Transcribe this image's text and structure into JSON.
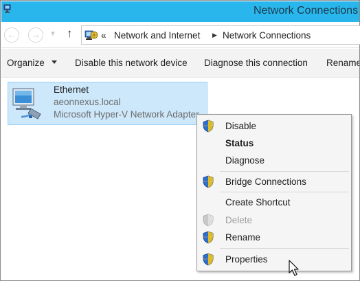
{
  "window": {
    "title": "Network Connections"
  },
  "navigation": {
    "back_icon": "back-arrow-icon",
    "forward_icon": "forward-arrow-icon",
    "up_icon": "up-arrow-icon",
    "overflow": "«",
    "breadcrumbs": [
      "Network and Internet",
      "Network Connections"
    ]
  },
  "commandbar": {
    "organize": "Organize",
    "disable": "Disable this network device",
    "diagnose": "Diagnose this connection",
    "rename": "Rename this connection"
  },
  "connection": {
    "name": "Ethernet",
    "domain": "aeonnexus.local",
    "adapter": "Microsoft Hyper-V Network Adapter"
  },
  "context_menu": {
    "items": [
      {
        "label": "Disable",
        "shield": true,
        "bold": false,
        "enabled": true
      },
      {
        "label": "Status",
        "shield": false,
        "bold": true,
        "enabled": true
      },
      {
        "label": "Diagnose",
        "shield": false,
        "bold": false,
        "enabled": true
      },
      {
        "label": "Bridge Connections",
        "shield": true,
        "bold": false,
        "enabled": true
      },
      {
        "label": "Create Shortcut",
        "shield": false,
        "bold": false,
        "enabled": true
      },
      {
        "label": "Delete",
        "shield": true,
        "bold": false,
        "enabled": false
      },
      {
        "label": "Rename",
        "shield": true,
        "bold": false,
        "enabled": true
      },
      {
        "label": "Properties",
        "shield": true,
        "bold": false,
        "enabled": true
      }
    ]
  },
  "colors": {
    "titlebar": "#29b6ec",
    "selection": "#cde8fb",
    "shield_blue": "#2d6fd0",
    "shield_yellow": "#f2c318"
  }
}
